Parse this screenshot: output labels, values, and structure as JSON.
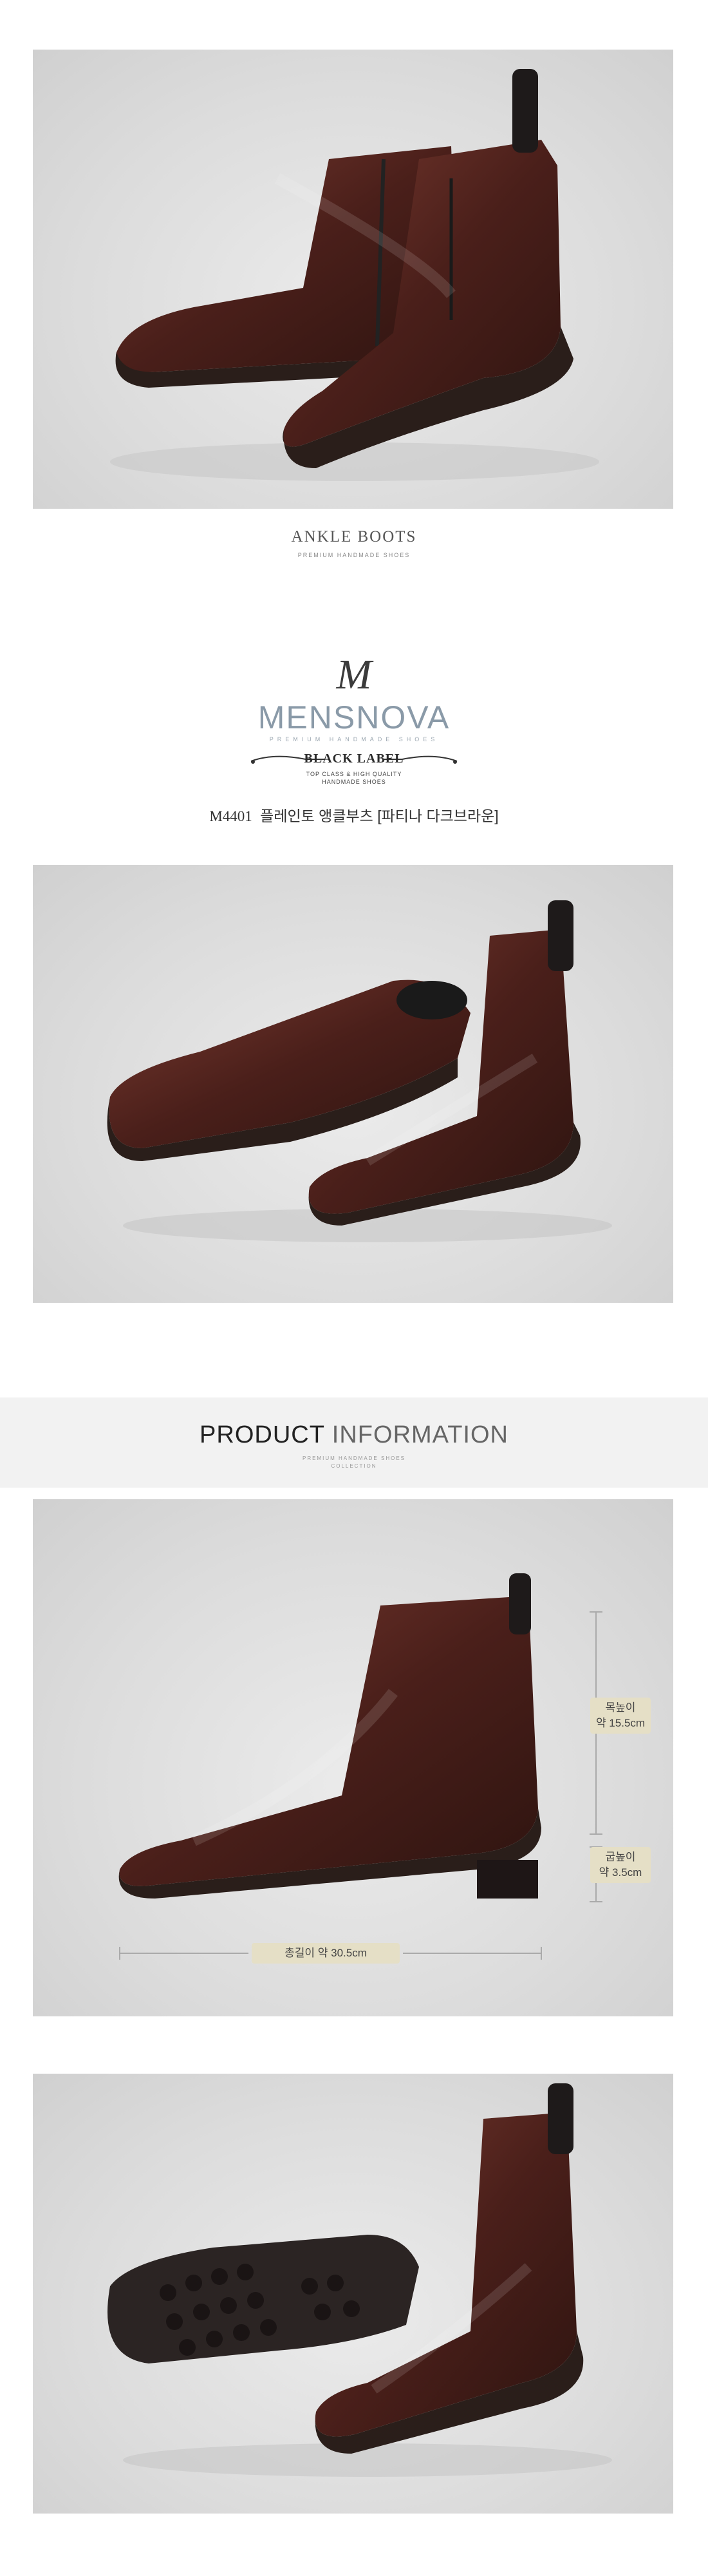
{
  "section1": {
    "title": "ANKLE BOOTS",
    "subtitle": "PREMIUM HANDMADE SHOES"
  },
  "brand": {
    "mark": "M",
    "name": "MENSNOVA",
    "tagline": "PREMIUM HANDMADE SHOES",
    "label_title": "BLACK LABEL",
    "label_line1": "TOP CLASS & HIGH QUALITY",
    "label_line2": "HANDMADE SHOES"
  },
  "product": {
    "code": "M4401",
    "name": "플레인토 앵클부츠 [파티나 다크브라운]"
  },
  "info": {
    "title_bold": "PRODUCT",
    "title_light": "INFORMATION",
    "sub1": "PREMIUM HANDMADE SHOES",
    "sub2": "COLLECTION"
  },
  "measurements": {
    "shaft_label": "목높이",
    "shaft_value": "약 15.5cm",
    "heel_label": "굽높이",
    "heel_value": "약 3.5cm",
    "length_text": "총길이 약 30.5cm"
  },
  "colors": {
    "leather": "#4a1f1a",
    "leather_highlight": "#7a3a30",
    "sole": "#2a1e1a",
    "label_bg": "#e5dfc6"
  }
}
